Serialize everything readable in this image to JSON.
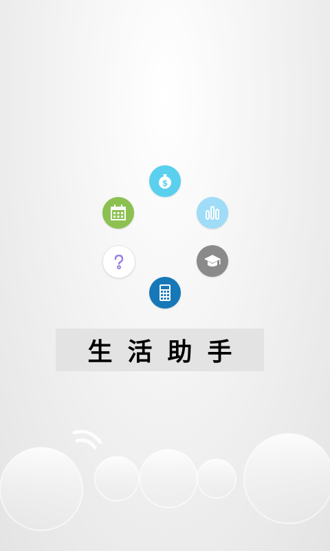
{
  "app": {
    "title": "生活助手"
  },
  "menu": [
    {
      "id": "finance",
      "icon": "money-bag-icon",
      "color": "#5bd0ee"
    },
    {
      "id": "stats",
      "icon": "bar-chart-icon",
      "color": "#9fdcf7"
    },
    {
      "id": "education",
      "icon": "graduation-cap-icon",
      "color": "#8a8a8a"
    },
    {
      "id": "calculator",
      "icon": "calculator-icon",
      "color": "#1778b8"
    },
    {
      "id": "help",
      "icon": "question-icon",
      "color": "#ffffff"
    },
    {
      "id": "calendar",
      "icon": "calendar-icon",
      "color": "#8cc152"
    }
  ]
}
